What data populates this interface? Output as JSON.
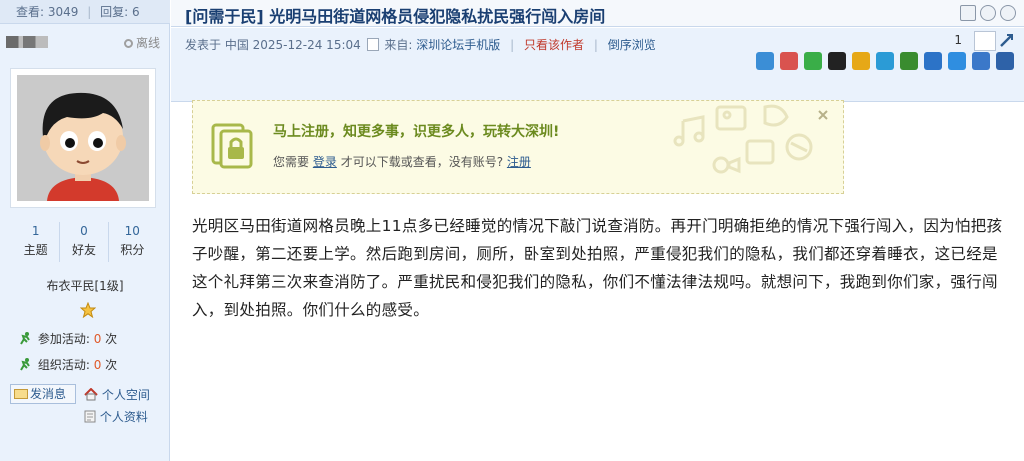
{
  "left": {
    "stats": {
      "views_label": "查看:",
      "views": "3049",
      "replies_label": "回复:",
      "replies": "6"
    },
    "status": "离线",
    "user_stats": [
      {
        "value": "1",
        "label": "主题"
      },
      {
        "value": "0",
        "label": "好友"
      },
      {
        "value": "10",
        "label": "积分"
      }
    ],
    "rank": "布衣平民[1级]",
    "activities": [
      {
        "label": "参加活动:",
        "value": "0",
        "unit": "次"
      },
      {
        "label": "组织活动:",
        "value": "0",
        "unit": "次"
      }
    ],
    "send_message": "发消息",
    "personal_space": "个人空间",
    "personal_profile": "个人资料"
  },
  "thread": {
    "title": "[问需于民] 光明马田街道网格员侵犯隐私扰民强行闯入房间"
  },
  "meta": {
    "posted_prefix": "发表于 中国 2025-12-24 15:04",
    "from_label": "来自:",
    "from_source": "深圳论坛手机版",
    "only_author": "只看该作者",
    "reverse": "倒序浏览",
    "floor": "1"
  },
  "notice": {
    "title": "马上注册，知更多事，识更多人，玩转大深圳!",
    "text_prefix": "您需要",
    "login": "登录",
    "text_middle": "才可以下载或查看，没有账号?",
    "register": "注册"
  },
  "post": {
    "content": "光明区马田街道网格员晚上11点多已经睡觉的情况下敲门说查消防。再开门明确拒绝的情况下强行闯入，因为怕把孩子吵醒，第二还要上学。然后跑到房间，厕所，卧室到处拍照，严重侵犯我们的隐私，我们都还穿着睡衣，这已经是这个礼拜第三次来查消防了。严重扰民和侵犯我们的隐私，你们不懂法律法规吗。就想问下，我跑到你们家，强行闯入，到处拍照。你们什么的感受。"
  },
  "icons": {
    "share": [
      {
        "name": "share-qzone-icon",
        "color": "#3b8ed6"
      },
      {
        "name": "share-renren-icon",
        "color": "#d9534f"
      },
      {
        "name": "share-wechat-icon",
        "color": "#3aae48"
      },
      {
        "name": "share-qq-icon",
        "color": "#222222"
      },
      {
        "name": "share-weibo-icon",
        "color": "#e6a817"
      },
      {
        "name": "share-pengyou-icon",
        "color": "#2b9bd6"
      },
      {
        "name": "share-douban-icon",
        "color": "#3a8c2f"
      },
      {
        "name": "share-kaixin-icon",
        "color": "#2c73c7"
      },
      {
        "name": "share-tqq-icon",
        "color": "#2f8ee0"
      },
      {
        "name": "share-more-icon",
        "color": "#3b78c9"
      },
      {
        "name": "share-people-icon",
        "color": "#2e62a8"
      }
    ]
  }
}
